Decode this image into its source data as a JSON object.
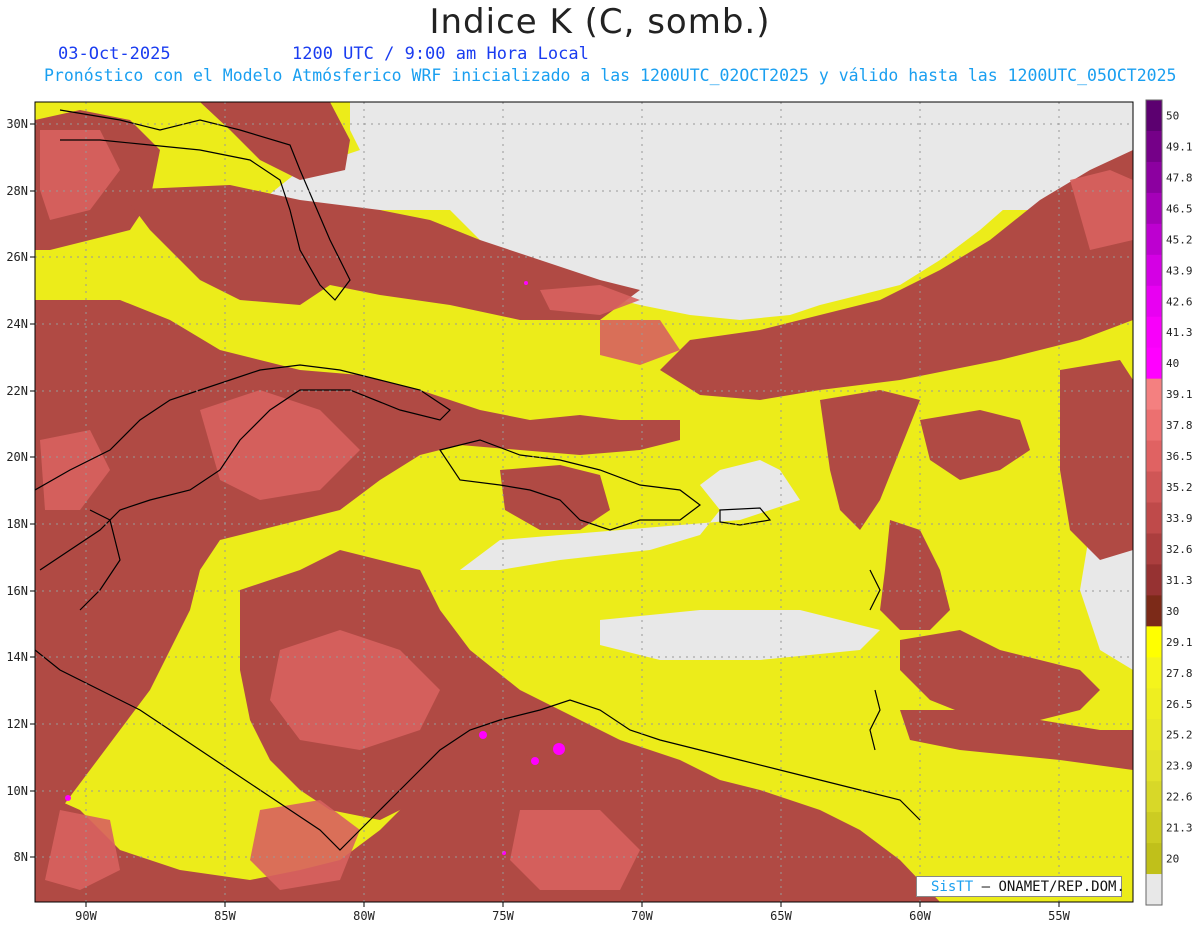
{
  "header": {
    "title": "Indice K (C, somb.)",
    "date": "03-Oct-2025",
    "time": "1200 UTC / 9:00 am Hora Local",
    "subtitle": "Pronóstico con el Modelo Atmósferico WRF inicializado a las 1200UTC_02OCT2025 y válido hasta las  1200UTC_05OCT2025"
  },
  "map": {
    "lon_range": [
      -92,
      -52.5
    ],
    "lat_range": [
      6.5,
      30.5
    ],
    "lon_ticks": [
      "90W",
      "85W",
      "80W",
      "75W",
      "70W",
      "65W",
      "60W",
      "55W"
    ],
    "lat_ticks": [
      "30N",
      "28N",
      "26N",
      "24N",
      "22N",
      "20N",
      "18N",
      "16N",
      "14N",
      "12N",
      "10N",
      "8N"
    ],
    "grid": true,
    "colors": {
      "land_border": "#000000",
      "gridline": "#999999",
      "below_scale": "#e8e8e8"
    }
  },
  "legend": {
    "labels": [
      "50",
      "49.1",
      "47.8",
      "46.5",
      "45.2",
      "43.9",
      "42.6",
      "41.3",
      "40",
      "39.1",
      "37.8",
      "36.5",
      "35.2",
      "33.9",
      "32.6",
      "31.3",
      "30",
      "29.1",
      "27.8",
      "26.5",
      "25.2",
      "23.9",
      "22.6",
      "21.3",
      "20"
    ],
    "colors": [
      "#5c0070",
      "#750088",
      "#8c00a0",
      "#a500b8",
      "#bd00d0",
      "#d400e4",
      "#e800f2",
      "#f800fa",
      "#ff00ff",
      "#f48080",
      "#ec7070",
      "#e06262",
      "#cf5656",
      "#bf4a4a",
      "#ab3e3e",
      "#963232",
      "#7c2a18",
      "#ffff00",
      "#f4f41c",
      "#eeee20",
      "#e8e826",
      "#e2e22a",
      "#d8d828",
      "#cccc22",
      "#c0c01a",
      "#e8e8e8"
    ]
  },
  "credit": {
    "brand": "SisTT",
    "org": " – ONAMET/REP.DOM."
  }
}
